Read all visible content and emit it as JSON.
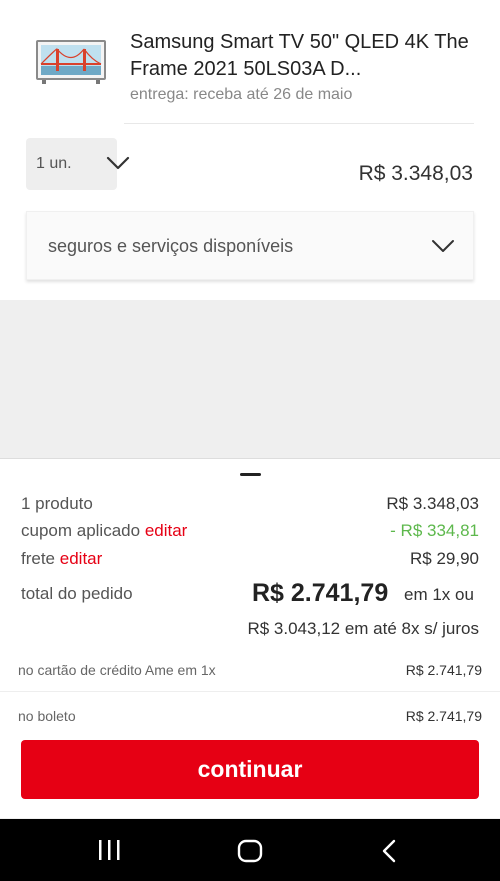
{
  "product": {
    "title": "Samsung Smart TV 50\" QLED 4K The Frame 2021 50LS03A D...",
    "delivery": "entrega: receba até 26 de maio",
    "quantity": "1 un.",
    "price": "R$ 3.348,03",
    "thumb_icon": "tv-frame-icon"
  },
  "services": {
    "label": "seguros e serviços disponíveis"
  },
  "summary": {
    "products_label": "1 produto",
    "products_value": "R$ 3.348,03",
    "coupon_label": "cupom aplicado",
    "coupon_edit": "editar",
    "coupon_value": "- R$ 334,81",
    "shipping_label": "frete",
    "shipping_edit": "editar",
    "shipping_value": "R$ 29,90",
    "total_label": "total do pedido",
    "total_value": "R$ 2.741,79",
    "total_suffix": "em 1x ou",
    "installment": "R$ 3.043,12 em até 8x s/ juros",
    "card_label": "no cartão de crédito Ame em 1x",
    "card_value": "R$ 2.741,79",
    "boleto_label": "no boleto",
    "boleto_value": "R$ 2.741,79",
    "continue_label": "continuar"
  },
  "colors": {
    "accent": "#e60014",
    "discount": "#5db84c"
  }
}
